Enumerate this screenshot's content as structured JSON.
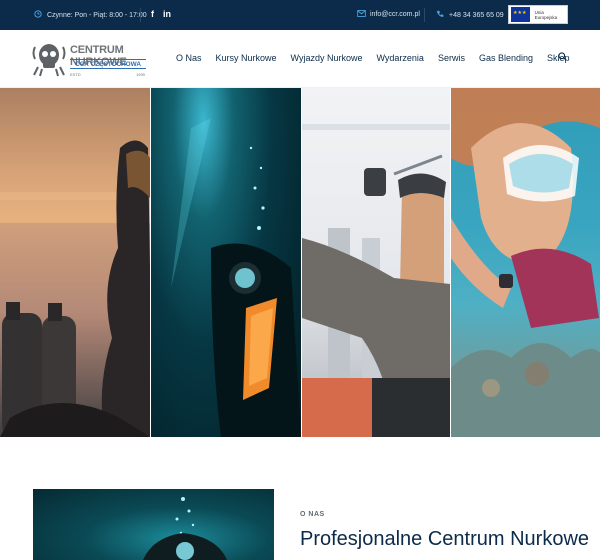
{
  "topbar": {
    "hours": "Czynne: Pon - Piąt: 8:00 - 17:00",
    "social": {
      "facebook": "f",
      "linkedin": "in"
    },
    "email": "info@ccr.com.pl",
    "phone": "+48 34 365 65 09",
    "eu_label": "Unia Europejska"
  },
  "logo": {
    "title": "CENTRUM NURKOWE",
    "subtitle": "CCR CZĘSTOCHOWA",
    "estd": "ESTD",
    "year": "1999"
  },
  "nav": {
    "items": [
      "O Nas",
      "Kursy Nurkowe",
      "Wyjazdy Nurkowe",
      "Wydarzenia",
      "Serwis",
      "Gas Blending",
      "Sklep"
    ]
  },
  "icons": {
    "clock": "clock-icon",
    "mail": "mail-icon",
    "phone": "phone-icon",
    "search": "search-icon"
  },
  "about": {
    "kicker": "O NAS",
    "title": "Profesjonalne Centrum Nurkowe"
  },
  "colors": {
    "topbar": "#0c2b4a",
    "accent": "#4aa3df",
    "heading": "#0c2b4a"
  }
}
